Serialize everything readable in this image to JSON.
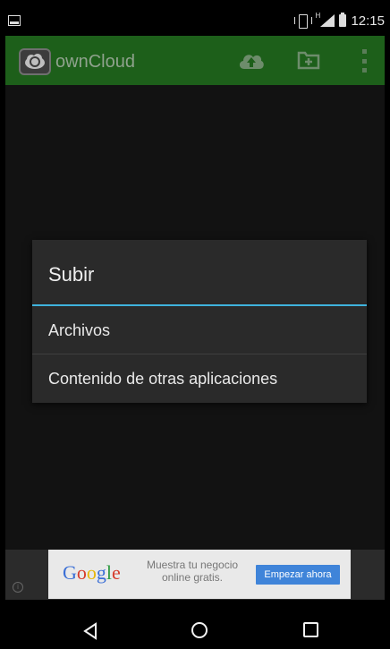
{
  "status_bar": {
    "time": "12:15",
    "signal_label": "H",
    "icons": [
      "image-notification-icon",
      "vibrate-icon",
      "signal-icon",
      "battery-icon"
    ]
  },
  "action_bar": {
    "title": "ownCloud",
    "icons": [
      "owncloud-logo-icon",
      "upload-icon",
      "new-folder-icon",
      "overflow-menu-icon"
    ]
  },
  "dialog": {
    "title": "Subir",
    "items": [
      {
        "label": "Archivos"
      },
      {
        "label": "Contenido de otras aplicaciones"
      }
    ]
  },
  "ad": {
    "brand": "Google",
    "text": "Muestra tu negocio online gratis.",
    "cta": "Empezar ahora"
  },
  "nav_bar": {
    "icons": [
      "back-icon",
      "home-icon",
      "recents-icon"
    ]
  },
  "colors": {
    "action_bar": "#1d5f1a",
    "dialog_bg": "#2a2a2a",
    "accent": "#3fb3dd",
    "ad_cta": "#3f84d9"
  }
}
